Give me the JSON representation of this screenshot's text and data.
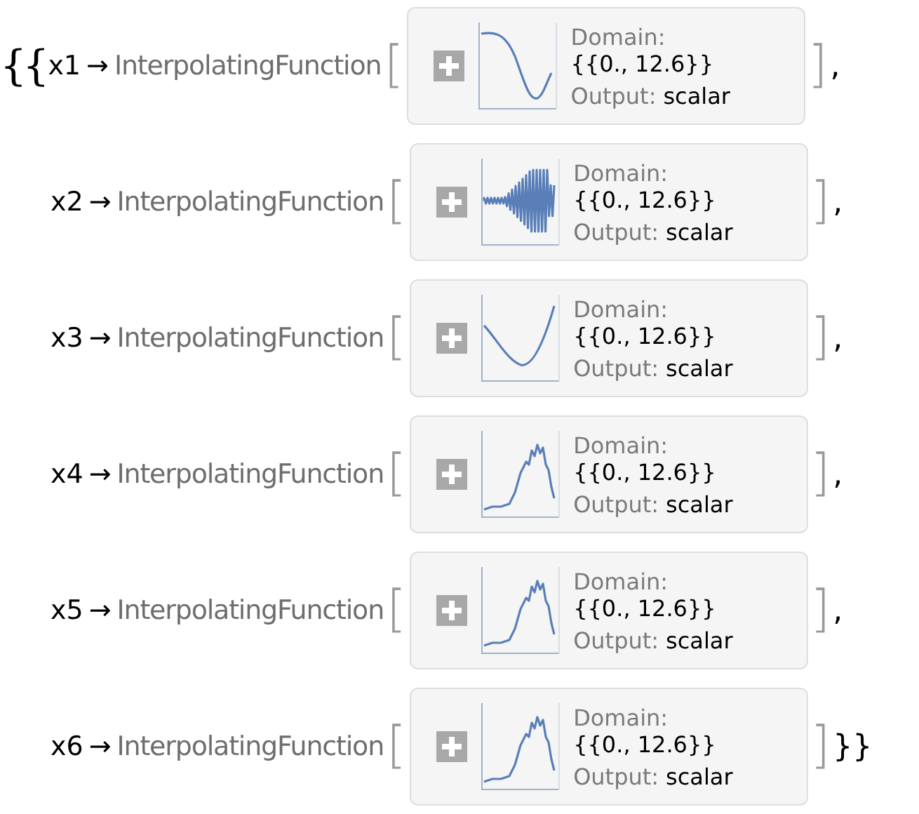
{
  "lead": "{{",
  "rows": [
    {
      "variable": "x1",
      "arrow": "→",
      "head": "InterpolatingFunction",
      "open": "[",
      "domain_label": "Domain:",
      "domain": "{{0., 12.6}}",
      "output_label": "Output:",
      "output": "scalar",
      "plot": {
        "kind": "dip"
      },
      "close": "]",
      "trail": ","
    },
    {
      "variable": "x2",
      "arrow": "→",
      "head": "InterpolatingFunction",
      "open": "[",
      "domain_label": "Domain:",
      "domain": "{{0., 12.6}}",
      "output_label": "Output:",
      "output": "scalar",
      "plot": {
        "kind": "oscillation"
      },
      "close": "]",
      "trail": ","
    },
    {
      "variable": "x3",
      "arrow": "→",
      "head": "InterpolatingFunction",
      "open": "[",
      "domain_label": "Domain:",
      "domain": "{{0., 12.6}}",
      "output_label": "Output:",
      "output": "scalar",
      "plot": {
        "kind": "valley"
      },
      "close": "]",
      "trail": ","
    },
    {
      "variable": "x4",
      "arrow": "→",
      "head": "InterpolatingFunction",
      "open": "[",
      "domain_label": "Domain:",
      "domain": "{{0., 12.6}}",
      "output_label": "Output:",
      "output": "scalar",
      "plot": {
        "kind": "peak"
      },
      "close": "]",
      "trail": ","
    },
    {
      "variable": "x5",
      "arrow": "→",
      "head": "InterpolatingFunction",
      "open": "[",
      "domain_label": "Domain:",
      "domain": "{{0., 12.6}}",
      "output_label": "Output:",
      "output": "scalar",
      "plot": {
        "kind": "peak"
      },
      "close": "]",
      "trail": ","
    },
    {
      "variable": "x6",
      "arrow": "→",
      "head": "InterpolatingFunction",
      "open": "[",
      "domain_label": "Domain:",
      "domain": "{{0., 12.6}}",
      "output_label": "Output:",
      "output": "scalar",
      "plot": {
        "kind": "peak"
      },
      "close": "]",
      "trail": "}}"
    }
  ]
}
